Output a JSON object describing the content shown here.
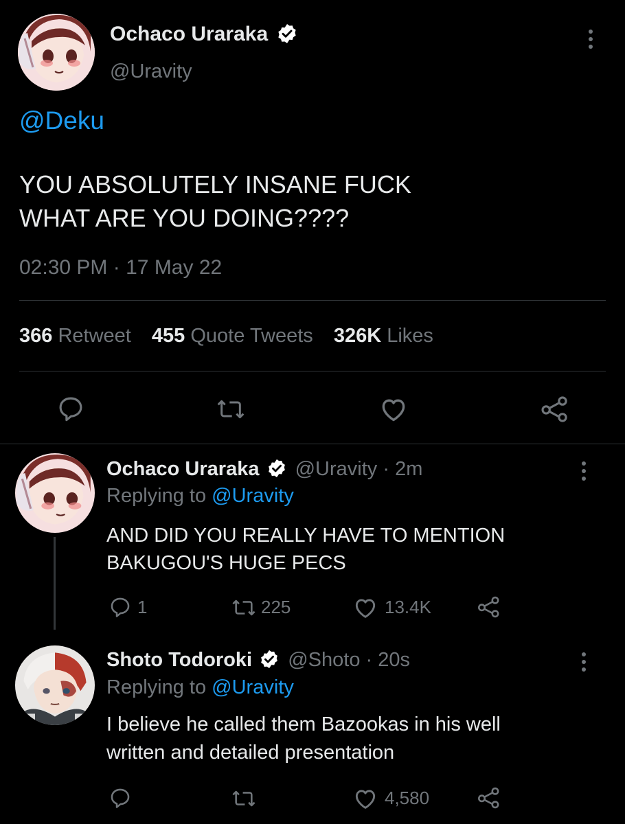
{
  "colors": {
    "background": "#000000",
    "text": "#e7e9ea",
    "muted": "#71767b",
    "link": "#1d9bf0",
    "divider": "#2f3336",
    "verified_badge": "#ffffff"
  },
  "main_tweet": {
    "author_name": "Ochaco Uraraka",
    "author_handle": "@Uravity",
    "mention": "@Deku",
    "body_line1": "YOU ABSOLUTELY INSANE FUCK",
    "body_line2": "WHAT ARE YOU DOING????",
    "time": "02:30 PM",
    "separator": "·",
    "date": "17 May 22",
    "stats": {
      "retweets_count": "366",
      "retweets_label": "Retweet",
      "quotes_count": "455",
      "quotes_label": "Quote Tweets",
      "likes_count": "326K",
      "likes_label": "Likes"
    },
    "icons": [
      "reply-icon",
      "retweet-icon",
      "like-icon",
      "share-icon"
    ]
  },
  "replies": [
    {
      "author_name": "Ochaco Uraraka",
      "author_handle": "@Uravity",
      "separator": "·",
      "age": "2m",
      "replying_label": "Replying to",
      "replying_to": "@Uravity",
      "body_line1": "AND DID YOU REALLY HAVE TO MENTION",
      "body_line2": "BAKUGOU'S HUGE PECS",
      "reply_count": "1",
      "retweet_count": "225",
      "like_count": "13.4K"
    },
    {
      "author_name": "Shoto Todoroki",
      "author_handle": "@Shoto",
      "separator": "·",
      "age": "20s",
      "replying_label": "Replying to",
      "replying_to": "@Uravity",
      "body_line1": "I believe he called them Bazookas in his well",
      "body_line2": "written and detailed presentation",
      "reply_count": "",
      "retweet_count": "",
      "like_count": "4,580"
    }
  ]
}
